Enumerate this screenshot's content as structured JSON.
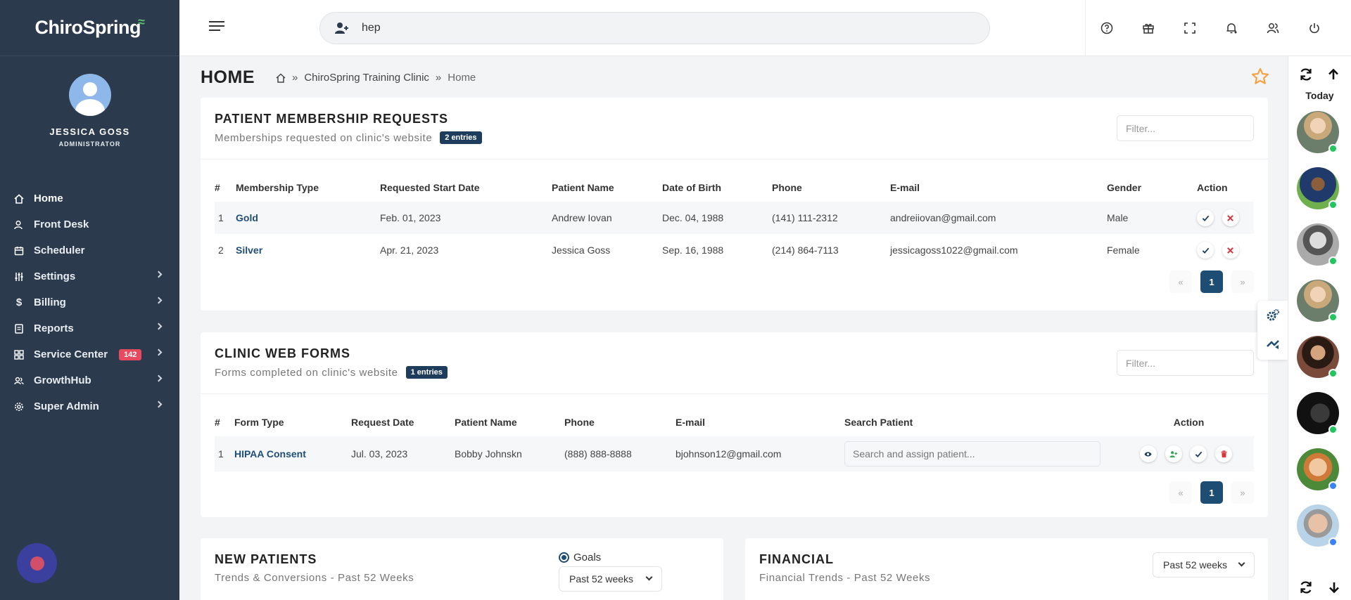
{
  "brand": {
    "name": "ChiroSpring"
  },
  "user": {
    "name": "JESSICA GOSS",
    "role": "ADMINISTRATOR"
  },
  "sidebar": {
    "items": [
      {
        "label": "Home",
        "icon": "home-icon",
        "active": true
      },
      {
        "label": "Front Desk",
        "icon": "front-desk-icon"
      },
      {
        "label": "Scheduler",
        "icon": "calendar-icon"
      },
      {
        "label": "Settings",
        "icon": "sliders-icon"
      },
      {
        "label": "Billing",
        "icon": "dollar-icon"
      },
      {
        "label": "Reports",
        "icon": "report-icon"
      },
      {
        "label": "Service Center",
        "icon": "grid-icon",
        "badge": "142"
      },
      {
        "label": "GrowthHub",
        "icon": "users-icon"
      },
      {
        "label": "Super Admin",
        "icon": "gear-icon"
      }
    ]
  },
  "search": {
    "value": "hep"
  },
  "page": {
    "title": "HOME",
    "breadcrumb": [
      "ChiroSpring Training Clinic",
      "Home"
    ]
  },
  "membership": {
    "title": "PATIENT MEMBERSHIP REQUESTS",
    "subtitle": "Memberships requested on clinic's website",
    "badge": "2 entries",
    "filter_placeholder": "Filter...",
    "columns": [
      "#",
      "Membership Type",
      "Requested Start Date",
      "Patient Name",
      "Date of Birth",
      "Phone",
      "E-mail",
      "Gender",
      "Action"
    ],
    "rows": [
      {
        "num": "1",
        "type": "Gold",
        "start": "Feb. 01, 2023",
        "name": "Andrew Iovan",
        "dob": "Dec. 04, 1988",
        "phone": "(141) 111-2312",
        "email": "andreiiovan@gmail.com",
        "gender": "Male"
      },
      {
        "num": "2",
        "type": "Silver",
        "start": "Apr. 21, 2023",
        "name": "Jessica Goss",
        "dob": "Sep. 16, 1988",
        "phone": "(214) 864-7113",
        "email": "jessicagoss1022@gmail.com",
        "gender": "Female"
      }
    ],
    "pager": {
      "prev": "«",
      "current": "1",
      "next": "»"
    }
  },
  "webforms": {
    "title": "CLINIC WEB FORMS",
    "subtitle": "Forms completed on clinic's website",
    "badge": "1 entries",
    "filter_placeholder": "Filter...",
    "columns": [
      "#",
      "Form Type",
      "Request Date",
      "Patient Name",
      "Phone",
      "E-mail",
      "Search Patient",
      "Action"
    ],
    "rows": [
      {
        "num": "1",
        "type": "HIPAA Consent",
        "date": "Jul. 03, 2023",
        "name": "Bobby Johnskn",
        "phone": "(888) 888-8888",
        "email": "bjohnson12@gmail.com",
        "assign_placeholder": "Search and assign patient..."
      }
    ],
    "pager": {
      "prev": "«",
      "current": "1",
      "next": "»"
    }
  },
  "new_patients": {
    "title": "NEW PATIENTS",
    "subtitle": "Trends & Conversions - Past 52 Weeks",
    "goals_label": "Goals",
    "range": "Past 52 weeks"
  },
  "financial": {
    "title": "FINANCIAL",
    "subtitle": "Financial Trends - Past 52 Weeks",
    "range": "Past 52 weeks"
  },
  "right_sidebar": {
    "today_label": "Today",
    "contacts": [
      {
        "status": "online",
        "color": "#22c55e"
      },
      {
        "status": "online",
        "color": "#22c55e"
      },
      {
        "status": "online",
        "color": "#22c55e"
      },
      {
        "status": "online",
        "color": "#22c55e"
      },
      {
        "status": "online",
        "color": "#22c55e"
      },
      {
        "status": "online",
        "color": "#22c55e"
      },
      {
        "status": "away",
        "color": "#3b82f6"
      },
      {
        "status": "away",
        "color": "#3b82f6"
      }
    ]
  },
  "colors": {
    "sidebar": "#2b3a4d",
    "accent": "#1e4d73",
    "danger": "#e74a5e",
    "star": "#f4a13d"
  }
}
